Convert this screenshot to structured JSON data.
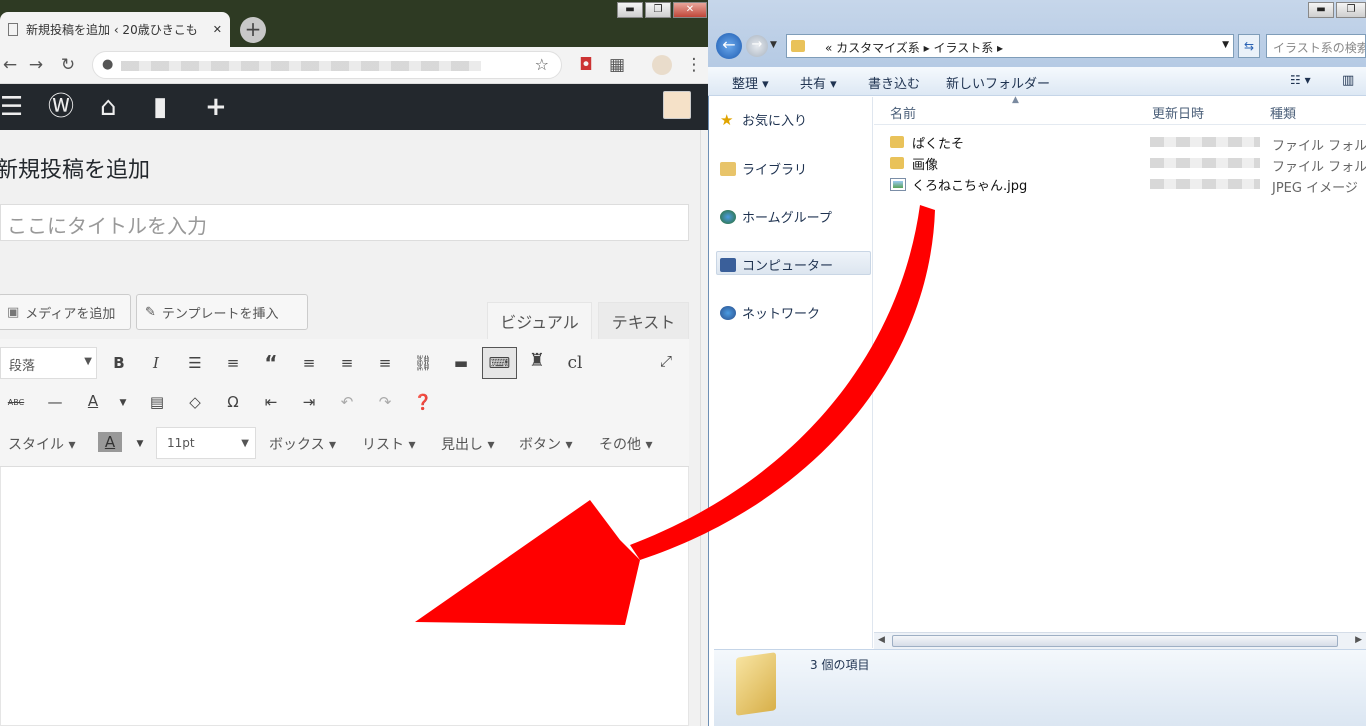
{
  "browser": {
    "tab_title": "新規投稿を追加 ‹ 20歳ひきこも",
    "tab_close": "✕",
    "new_tab": "+",
    "window_controls": [
      "▬",
      "❐",
      "✕"
    ]
  },
  "wp_admin_bar": {
    "icons": [
      "menu-icon",
      "wordpress-icon",
      "home-icon",
      "comment-icon",
      "plus-icon"
    ]
  },
  "editor_page": {
    "page_title": "新規投稿を追加",
    "title_placeholder": "ここにタイトルを入力",
    "add_media_button": "メディアを追加",
    "insert_template_button": "テンプレートを挿入",
    "tab_visual": "ビジュアル",
    "tab_text": "テキスト",
    "format_select": "段落",
    "font_size_select": "11pt",
    "toolbar_third_row": {
      "style": "スタイル ▾",
      "box": "ボックス ▾",
      "list": "リスト ▾",
      "heading": "見出し ▾",
      "button": "ボタン ▾",
      "other": "その他 ▾"
    },
    "cl_label": "cl"
  },
  "explorer": {
    "breadcrumb": [
      "«",
      "カスタマイズ系",
      "▸",
      "イラスト系",
      "▸"
    ],
    "breadcrumb_text": "«  カスタマイズ系  ▸  イラスト系  ▸",
    "search_placeholder": "イラスト系の検索",
    "commands": {
      "organize": "整理 ▾",
      "share": "共有 ▾",
      "burn": "書き込む",
      "new_folder": "新しいフォルダー"
    },
    "nav_items": [
      "お気に入り",
      "ライブラリ",
      "ホームグループ",
      "コンピューター",
      "ネットワーク"
    ],
    "columns": {
      "name": "名前",
      "modified": "更新日時",
      "type": "種類"
    },
    "files": [
      {
        "name": "ぱくたそ",
        "type": "ファイル フォル..."
      },
      {
        "name": "画像",
        "type": "ファイル フォル..."
      },
      {
        "name": "くろねこちゃん.jpg",
        "type": "JPEG イメージ"
      }
    ],
    "item_count": "3 個の項目"
  },
  "colors": {
    "wp_admin_bar": "#23282d",
    "arrow": "#ff0000",
    "explorer_chrome": "#c6d6ea"
  }
}
